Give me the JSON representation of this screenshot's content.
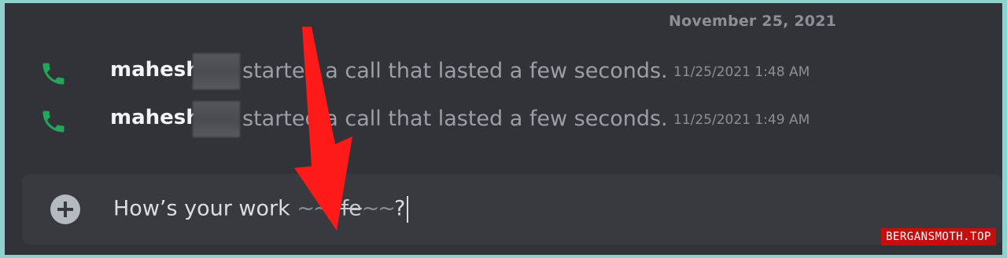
{
  "chat": {
    "date_divider": "November 25, 2021",
    "calls": [
      {
        "user": "mahesh",
        "message": "started a call that lasted a few seconds.",
        "timestamp": "11/25/2021 1:48 AM",
        "icon": "phone-icon"
      },
      {
        "user": "mahesh",
        "message": "started a call that lasted a few seconds.",
        "timestamp": "11/25/2021 1:49 AM",
        "icon": "phone-icon"
      }
    ]
  },
  "composer": {
    "text_before": "How’s your work ",
    "strike_open": "~~",
    "struck_word": "life",
    "strike_close": "~~",
    "text_after": "?"
  },
  "annotation": {
    "type": "red-arrow",
    "color": "#ff1a1a"
  },
  "watermark": "BERGANSMOTH.TOP",
  "colors": {
    "background": "#313338",
    "composer": "#383a40",
    "call_icon": "#23a55a",
    "frame": "#8fd1cc"
  }
}
